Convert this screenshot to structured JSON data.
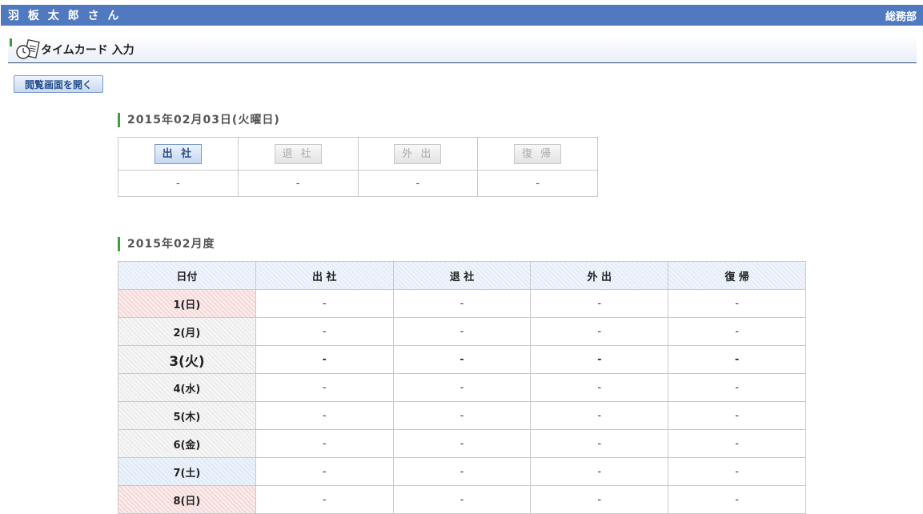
{
  "header": {
    "user_name": "羽 板 太 郎 さ ん",
    "department": "総務部"
  },
  "section": {
    "title": "タイムカード 入力",
    "icon": "timecard-clock-icon"
  },
  "open_view_button": "閲覧画面を開く",
  "today": {
    "date_heading": "2015年02月03日(火曜日)",
    "buttons": [
      {
        "label": "出 社",
        "active": true
      },
      {
        "label": "退 社",
        "active": false
      },
      {
        "label": "外 出",
        "active": false
      },
      {
        "label": "復 帰",
        "active": false
      }
    ],
    "values": [
      "-",
      "-",
      "-",
      "-"
    ]
  },
  "month": {
    "heading": "2015年02月度",
    "columns": [
      "日付",
      "出 社",
      "退 社",
      "外 出",
      "復 帰"
    ],
    "rows": [
      {
        "date": "1(日)",
        "values": [
          "-",
          "-",
          "-",
          "-"
        ]
      },
      {
        "date": "2(月)",
        "values": [
          "-",
          "-",
          "-",
          "-"
        ]
      },
      {
        "date": "3(火)",
        "values": [
          "-",
          "-",
          "-",
          "-"
        ]
      },
      {
        "date": "4(水)",
        "values": [
          "-",
          "-",
          "-",
          "-"
        ]
      },
      {
        "date": "5(木)",
        "values": [
          "-",
          "-",
          "-",
          "-"
        ]
      },
      {
        "date": "6(金)",
        "values": [
          "-",
          "-",
          "-",
          "-"
        ]
      },
      {
        "date": "7(土)",
        "values": [
          "-",
          "-",
          "-",
          "-"
        ]
      },
      {
        "date": "8(日)",
        "values": [
          "-",
          "-",
          "-",
          "-"
        ]
      }
    ]
  },
  "colors": {
    "topbar": "#5079c0",
    "accent_green": "#3ba33b",
    "sunday": "#f5d8d8",
    "saturday": "#dfe9f7"
  }
}
